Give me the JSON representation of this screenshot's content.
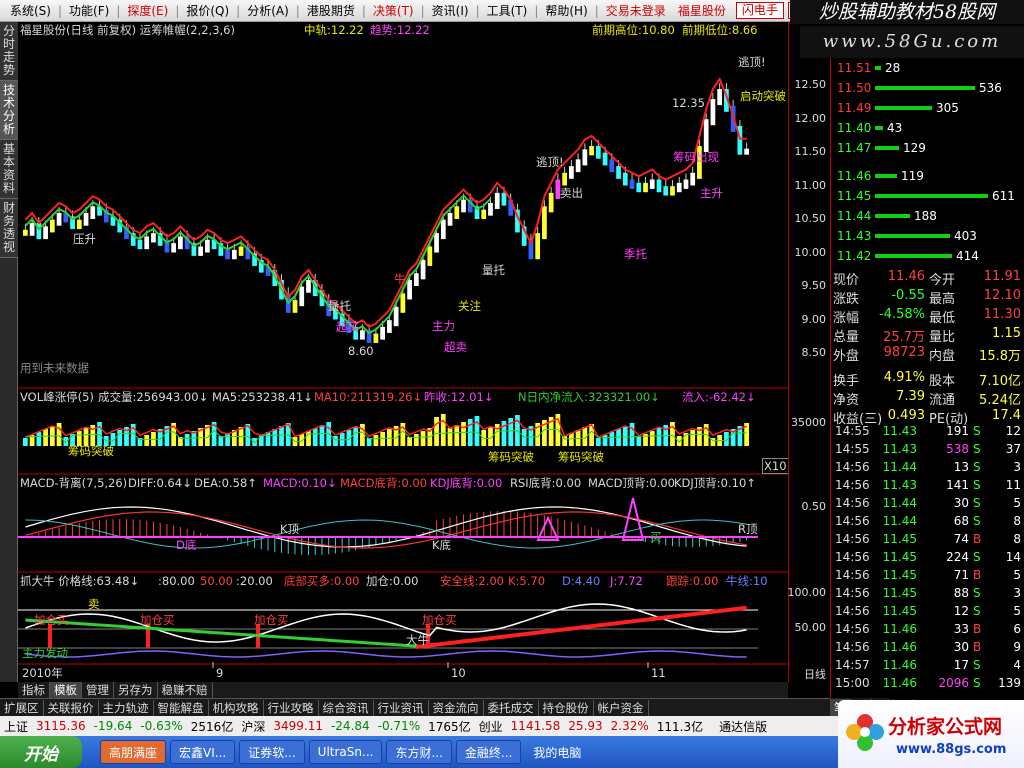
{
  "menu": {
    "items": [
      "系统(S)",
      "功能(F)",
      "探度(E)",
      "报价(Q)",
      "分析(A)",
      "港股期货",
      "决策(T)",
      "资讯(I)",
      "工具(T)",
      "帮助(H)"
    ],
    "login": "交易未登录",
    "stock": "福星股份",
    "btn1": "闪电手",
    "btn2": "行 情"
  },
  "brand": {
    "line1": "炒股辅助教材58股网",
    "line2": "www.58Gu.com"
  },
  "vtabs": [
    "分时走势",
    "技术分析",
    "基本资料",
    "财务透视"
  ],
  "main": {
    "header": {
      "name": "福星股份(日线 前复权) 运筹帷幄(2,2,3,6)",
      "mid": "中轨:12.22",
      "trend": "趋势:12.22",
      "prevhigh": "前期高位:10.80",
      "prevlow": "前期低位:8.66"
    },
    "labels": {
      "escape1": "逃顶!",
      "escape2": "逃顶!",
      "liftup": "启动突破",
      "pressure": "压升",
      "hold": "超买",
      "oversold": "超卖",
      "cow": "牛",
      "follow": "关注",
      "hot": "主力",
      "strong": "量托",
      "dep": "筹码出现",
      "support": "季托",
      "p1235": "12.35",
      "p860": "8.60",
      "future": "用到未来数据",
      "sell": "卖出",
      "push": "主升"
    }
  },
  "vol": {
    "header": {
      "title": "VOL峰涨停(5)",
      "vol": "成交量:256943.00↓",
      "ma5": "MA5:253238.41↓",
      "ma10": "MA10:211319.26↓",
      "prev": "昨收:12.01↓",
      "inflow": "N日内净流入:323321.00↓",
      "flow": "流入:-62.42↓"
    },
    "tick35000": "35000",
    "x10": "X10",
    "chip": "筹码突破"
  },
  "macd": {
    "header": {
      "title": "MACD-背离(7,5,26)",
      "diff": "DIFF:0.64↓",
      "dea": "DEA:0.58↑",
      "macd": "MACD:0.10↓",
      "bottom": "MACD底背:0.00",
      "kdj": "KDJ底背:0.00",
      "rsi": "RSI底背:0.00",
      "macdtop": "MACD顶背:0.00",
      "kdjtop": "KDJ顶背:0.10↑"
    },
    "tick": "0.50",
    "ktop": "K顶",
    "rtop": "R顶",
    "dbottom": "D底",
    "kbottom": "K底",
    "buy": "买",
    "rbottom": "R底"
  },
  "grab": {
    "header": {
      "title": "抓大牛  价格线:63.48↓",
      "v80": ":80.00",
      "v50": "50.00",
      "v20": ":20.00",
      "bottom": "底部买多:0.00",
      "add": "加仓:0.00",
      "safe": "安全线:2.00",
      "k": "K:5.70",
      "d": "D:4.40",
      "j": "J:7.72",
      "follow": "跟踪:0.00",
      "cow": "牛线:10"
    },
    "t100": "100.00",
    "t50": "50.00",
    "sell": "卖",
    "addbuy": "加仓买",
    "bull": "大牛",
    "main": "主力发动"
  },
  "xaxis": {
    "year": "2010年",
    "m9": "9",
    "m10": "10",
    "m11": "11",
    "period": "日线"
  },
  "yaxis": [
    "12.50",
    "12.00",
    "11.50",
    "11.00",
    "10.50",
    "10.00",
    "9.50",
    "9.00",
    "8.50"
  ],
  "orderbook": {
    "asks": [
      {
        "p": "11.51",
        "v": "28"
      },
      {
        "p": "11.50",
        "v": "536"
      },
      {
        "p": "11.49",
        "v": "305"
      },
      {
        "p": "11.40",
        "v": "43"
      },
      {
        "p": "11.47",
        "v": "129"
      }
    ],
    "bids": [
      {
        "p": "11.46",
        "v": "119"
      },
      {
        "p": "11.45",
        "v": "611"
      },
      {
        "p": "11.44",
        "v": "188"
      },
      {
        "p": "11.43",
        "v": "403"
      },
      {
        "p": "11.42",
        "v": "414"
      }
    ]
  },
  "quote": [
    [
      "现价",
      "11.46",
      "今开",
      "11.91"
    ],
    [
      "涨跌",
      "-0.55",
      "最高",
      "12.10"
    ],
    [
      "涨幅",
      "-4.58%",
      "最低",
      "11.30"
    ],
    [
      "总量",
      "25.7万",
      "量比",
      "1.15"
    ],
    [
      "外盘",
      "98723",
      "内盘",
      "15.8万"
    ],
    [
      "换手",
      "4.91%",
      "股本",
      "7.10亿"
    ],
    [
      "净资",
      "7.39",
      "流通",
      "5.24亿"
    ],
    [
      "收益(三)",
      "0.493",
      "PE(动)",
      "17.4"
    ]
  ],
  "ticks": [
    [
      "14:55",
      "11.43",
      "191",
      "S",
      "12"
    ],
    [
      "14:55",
      "11.43",
      "538",
      "S",
      "37"
    ],
    [
      "14:56",
      "11.44",
      "13",
      "S",
      "3"
    ],
    [
      "14:56",
      "11.43",
      "141",
      "S",
      "11"
    ],
    [
      "14:56",
      "11.44",
      "30",
      "S",
      "5"
    ],
    [
      "14:56",
      "11.44",
      "68",
      "S",
      "8"
    ],
    [
      "14:56",
      "11.45",
      "74",
      "B",
      "8"
    ],
    [
      "14:56",
      "11.45",
      "224",
      "S",
      "14"
    ],
    [
      "14:56",
      "11.45",
      "71",
      "B",
      "5"
    ],
    [
      "14:56",
      "11.45",
      "88",
      "S",
      "3"
    ],
    [
      "14:56",
      "11.45",
      "12",
      "S",
      "5"
    ],
    [
      "14:56",
      "11.46",
      "33",
      "B",
      "6"
    ],
    [
      "14:56",
      "11.46",
      "30",
      "B",
      "9"
    ],
    [
      "14:57",
      "11.46",
      "17",
      "S",
      "4"
    ],
    [
      "15:00",
      "11.46",
      "2096",
      "S",
      "139"
    ]
  ],
  "tabs1": [
    "指标",
    "模板",
    "管理",
    "另存为",
    "稳赚不赔"
  ],
  "tabs2": [
    "扩展区",
    "关联报价",
    "主力轨迹",
    "智能解盘",
    "机构攻略",
    "行业攻略",
    "综合资讯",
    "行业资讯",
    "资金流向",
    "委托成交",
    "持仓股份",
    "帐户资金"
  ],
  "rtabs": [
    "笔",
    "价",
    "细",
    "势"
  ],
  "status": {
    "sh": "上证",
    "shv": "3115.36",
    "shc": "-19.64",
    "shp": "-0.63%",
    "sha": "2516亿",
    "sz": "沪深",
    "szv": "3499.11",
    "szc": "-24.84",
    "szp": "-0.71%",
    "sza": "1765亿",
    "cy": "创业",
    "cyv": "1141.58",
    "cyc": "25.93",
    "cyp": "2.32%",
    "cya": "111.3亿",
    "vendor": "通达信版"
  },
  "taskbar": {
    "start": "开始",
    "items": [
      "高朋满座",
      "宏鑫VI...",
      "证券软...",
      "UltraSn...",
      "东方财...",
      "金融终..."
    ],
    "tray": "我的电脑"
  },
  "watermark": {
    "title": "分析家公式网",
    "url": "www.88gs.com"
  }
}
